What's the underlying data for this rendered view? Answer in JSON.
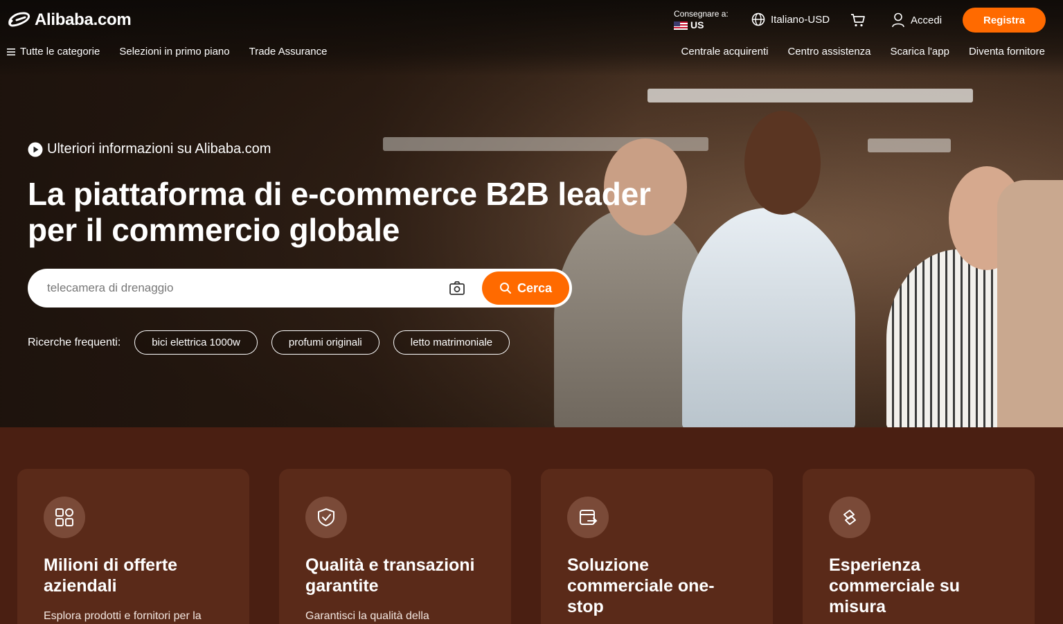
{
  "header": {
    "logo_text": "Alibaba.com",
    "ship_to_label": "Consegnare a:",
    "ship_to_country": "US",
    "language_currency": "Italiano-USD",
    "sign_in": "Accedi",
    "register": "Registra"
  },
  "nav_left": [
    {
      "label": "Tutte le categorie",
      "icon": "menu-icon"
    },
    {
      "label": "Selezioni in primo piano"
    },
    {
      "label": "Trade Assurance"
    }
  ],
  "nav_right": [
    {
      "label": "Centrale acquirenti"
    },
    {
      "label": "Centro assistenza"
    },
    {
      "label": "Scarica l'app"
    },
    {
      "label": "Diventa fornitore"
    }
  ],
  "hero": {
    "learn_more": "Ulteriori informazioni su Alibaba.com",
    "headline_line1": "La piattaforma di e-commerce B2B leader",
    "headline_line2": "per il commercio globale"
  },
  "search": {
    "placeholder": "telecamera di drenaggio",
    "button": "Cerca"
  },
  "frequent": {
    "label": "Ricerche frequenti:",
    "chips": [
      "bici elettrica 1000w",
      "profumi originali",
      "letto matrimoniale"
    ]
  },
  "cards": [
    {
      "icon": "grid-icon",
      "title": "Milioni di offerte aziendali",
      "desc": "Esplora prodotti e fornitori per la"
    },
    {
      "icon": "shield-check-icon",
      "title": "Qualità e transazioni garantite",
      "desc": "Garantisci la qualità della"
    },
    {
      "icon": "card-transfer-icon",
      "title": "Soluzione commerciale one-stop",
      "desc": ""
    },
    {
      "icon": "tailored-icon",
      "title": "Esperienza commerciale su misura",
      "desc": ""
    }
  ],
  "colors": {
    "accent": "#ff6a00",
    "bottom_bg": "#4a1f12",
    "card_bg": "#5a2a19"
  }
}
